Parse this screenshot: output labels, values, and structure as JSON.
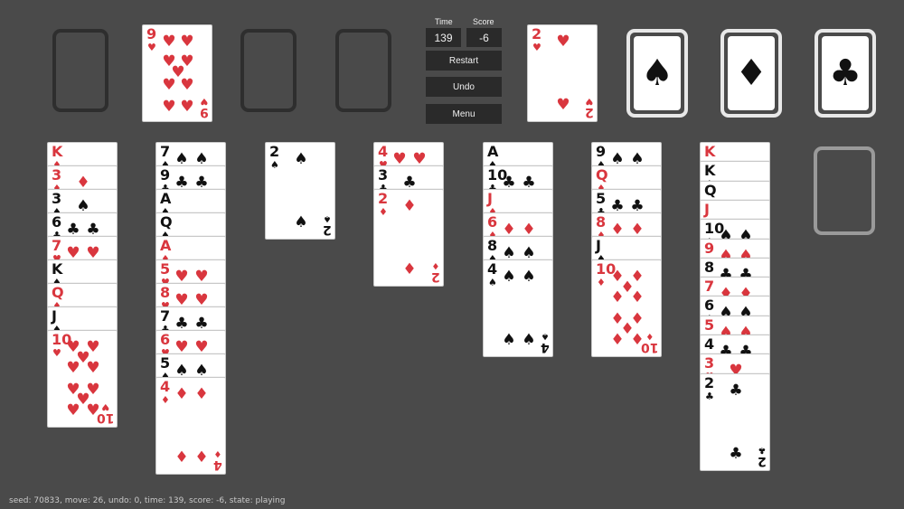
{
  "hud": {
    "time_label": "Time",
    "score_label": "Score",
    "time_value": "139",
    "score_value": "-6",
    "restart_label": "Restart",
    "undo_label": "Undo",
    "menu_label": "Menu"
  },
  "foundations": [
    {
      "symbol": "♠",
      "icon": "spade-icon"
    },
    {
      "symbol": "♦",
      "icon": "diamond-icon"
    },
    {
      "symbol": "♣",
      "icon": "club-icon"
    }
  ],
  "free_cell_card": {
    "rank": "9",
    "suit": "♥",
    "color": "red"
  },
  "center_card": {
    "rank": "2",
    "suit": "♥",
    "color": "red"
  },
  "columns": [
    [
      {
        "rank": "K",
        "suit": "♦",
        "color": "red"
      },
      {
        "rank": "3",
        "suit": "♦",
        "color": "red"
      },
      {
        "rank": "3",
        "suit": "♠",
        "color": "black"
      },
      {
        "rank": "6",
        "suit": "♣",
        "color": "black"
      },
      {
        "rank": "7",
        "suit": "♥",
        "color": "red"
      },
      {
        "rank": "K",
        "suit": "♠",
        "color": "black"
      },
      {
        "rank": "Q",
        "suit": "♦",
        "color": "red"
      },
      {
        "rank": "J",
        "suit": "♠",
        "color": "black"
      },
      {
        "rank": "10",
        "suit": "♥",
        "color": "red"
      }
    ],
    [
      {
        "rank": "7",
        "suit": "♠",
        "color": "black"
      },
      {
        "rank": "9",
        "suit": "♣",
        "color": "black"
      },
      {
        "rank": "A",
        "suit": "♠",
        "color": "black"
      },
      {
        "rank": "Q",
        "suit": "♠",
        "color": "black"
      },
      {
        "rank": "A",
        "suit": "♦",
        "color": "red"
      },
      {
        "rank": "5",
        "suit": "♥",
        "color": "red"
      },
      {
        "rank": "8",
        "suit": "♥",
        "color": "red"
      },
      {
        "rank": "7",
        "suit": "♣",
        "color": "black"
      },
      {
        "rank": "6",
        "suit": "♥",
        "color": "red"
      },
      {
        "rank": "5",
        "suit": "♠",
        "color": "black"
      },
      {
        "rank": "4",
        "suit": "♦",
        "color": "red"
      }
    ],
    [
      {
        "rank": "2",
        "suit": "♠",
        "color": "black"
      }
    ],
    [
      {
        "rank": "4",
        "suit": "♥",
        "color": "red"
      },
      {
        "rank": "3",
        "suit": "♣",
        "color": "black"
      },
      {
        "rank": "2",
        "suit": "♦",
        "color": "red"
      }
    ],
    [
      {
        "rank": "A",
        "suit": "♠",
        "color": "black"
      },
      {
        "rank": "10",
        "suit": "♣",
        "color": "black"
      },
      {
        "rank": "J",
        "suit": "♦",
        "color": "red"
      },
      {
        "rank": "6",
        "suit": "♦",
        "color": "red"
      },
      {
        "rank": "8",
        "suit": "♠",
        "color": "black"
      },
      {
        "rank": "4",
        "suit": "♠",
        "color": "black"
      }
    ],
    [
      {
        "rank": "9",
        "suit": "♠",
        "color": "black"
      },
      {
        "rank": "Q",
        "suit": "♦",
        "color": "red"
      },
      {
        "rank": "5",
        "suit": "♣",
        "color": "black"
      },
      {
        "rank": "8",
        "suit": "♦",
        "color": "red"
      },
      {
        "rank": "J",
        "suit": "♠",
        "color": "black"
      },
      {
        "rank": "10",
        "suit": "♦",
        "color": "red"
      }
    ],
    [
      {
        "rank": "K",
        "suit": "♦",
        "color": "red"
      },
      {
        "rank": "K",
        "suit": "♠",
        "color": "black"
      },
      {
        "rank": "Q",
        "suit": "♠",
        "color": "black"
      },
      {
        "rank": "J",
        "suit": "♦",
        "color": "red"
      },
      {
        "rank": "10",
        "suit": "♠",
        "color": "black"
      },
      {
        "rank": "9",
        "suit": "♠",
        "color": "red"
      },
      {
        "rank": "8",
        "suit": "♣",
        "color": "black"
      },
      {
        "rank": "7",
        "suit": "♦",
        "color": "red"
      },
      {
        "rank": "6",
        "suit": "♠",
        "color": "black"
      },
      {
        "rank": "5",
        "suit": "♠",
        "color": "red"
      },
      {
        "rank": "4",
        "suit": "♣",
        "color": "black"
      },
      {
        "rank": "3",
        "suit": "♥",
        "color": "red"
      },
      {
        "rank": "2",
        "suit": "♣",
        "color": "black"
      }
    ]
  ],
  "status_line": "seed: 70833,  move: 26,  undo: 0,  time: 139,  score: -6,  state: playing"
}
